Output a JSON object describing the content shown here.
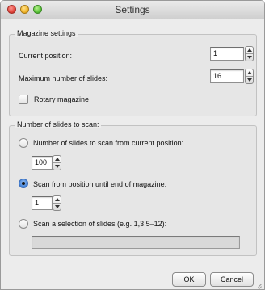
{
  "window": {
    "title": "Settings"
  },
  "magazine_settings": {
    "title": "Magazine settings",
    "current_position_label": "Current position:",
    "current_position_value": "1",
    "max_slides_label": "Maximum number of slides:",
    "max_slides_value": "16",
    "rotary_label": "Rotary magazine",
    "rotary_checked": false
  },
  "scan_settings": {
    "title": "Number of slides to scan:",
    "option_from_current_label": "Number of slides to scan from current position:",
    "option_from_current_value": "100",
    "option_until_end_label": "Scan from position until end of magazine:",
    "option_until_end_value": "1",
    "option_selection_label": "Scan a selection of slides (e.g. 1,3,5–12):",
    "option_selection_value": "",
    "selected_option": "until_end"
  },
  "buttons": {
    "ok_label": "OK",
    "cancel_label": "Cancel"
  },
  "icons": {
    "close": "close-icon",
    "minimize": "minimize-icon",
    "zoom": "zoom-icon",
    "stepper": "stepper-arrows-icon",
    "resize": "resize-grip-icon"
  },
  "colors": {
    "selected_radio": "#3f7fd6",
    "window_bg": "#ececec"
  }
}
